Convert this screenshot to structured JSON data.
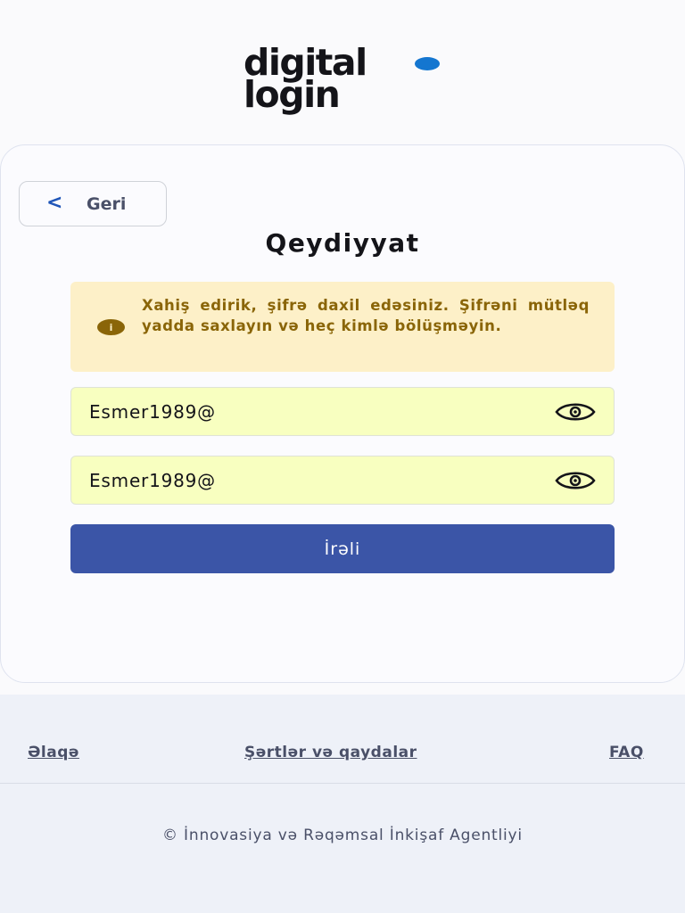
{
  "logo": {
    "line1": "digital",
    "line2": "login",
    "dot_color": "#1476d0"
  },
  "back_button": {
    "icon": "chevron-left-icon",
    "label": "Geri"
  },
  "page_title": "Qeydiyyat",
  "alert": {
    "icon": "info-icon",
    "text": "Xahiş edirik, şifrə daxil edəsiniz. Şifrəni mütləq yadda saxlayın və heç kimlə bölüşməyin.",
    "color": "#8a6508",
    "background": "#fdf0c8"
  },
  "fields": [
    {
      "value": "Esmer1989@",
      "icon": "eye-icon"
    },
    {
      "value": "Esmer1989@",
      "icon": "eye-icon"
    }
  ],
  "submit_button": {
    "label": "İrəli",
    "color": "#3b55a7"
  },
  "footer": {
    "links": [
      "Əlaqə",
      "Şərtlər və qaydalar",
      " FAQ"
    ],
    "copyright": "© İnnovasiya və Rəqəmsal İnkişaf Agentliyi"
  }
}
